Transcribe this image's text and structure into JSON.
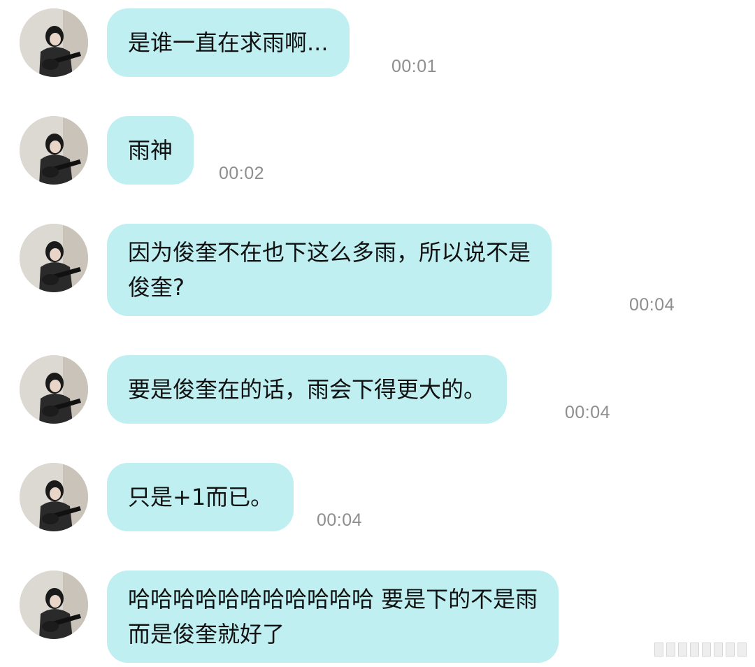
{
  "messages": [
    {
      "lines": [
        "是谁一直在求雨啊..."
      ],
      "time": "00:01"
    },
    {
      "lines": [
        "雨神"
      ],
      "time": "00:02"
    },
    {
      "lines": [
        "因为俊奎不在也下这么多雨，所以说不是",
        "俊奎?"
      ],
      "time": "00:04"
    },
    {
      "lines": [
        "要是俊奎在的话，雨会下得更大的。"
      ],
      "time": "00:04"
    },
    {
      "lines": [
        "只是+1而已。"
      ],
      "time": "00:04"
    },
    {
      "lines": [
        "哈哈哈哈哈哈哈哈哈哈哈 要是下的不是雨",
        "而是俊奎就好了"
      ],
      "time": ""
    }
  ],
  "colors": {
    "bubble": "#bfeff1",
    "text": "#111111",
    "time": "#8e8e8e",
    "background": "#ffffff"
  },
  "avatar_icon": "person-with-guitar-photo"
}
